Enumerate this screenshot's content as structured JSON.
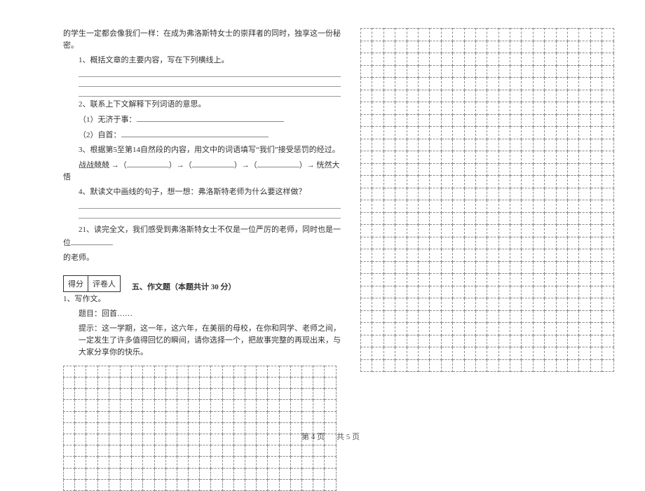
{
  "left": {
    "p0": "的学生一定都会像我们一样：在成为弗洛斯特女士的崇拜者的同时，独享这一份秘密。",
    "q1": "1、概括文章的主要内容，写在下列横线上。",
    "q2": "2、联系上下文解释下列词语的意思。",
    "q2a": "（1）无济于事：",
    "q2b": "（2）自首：",
    "q3": "3、根据第5至第14自然段的内容，用文中的词语填写“我们”接受惩罚的经过。",
    "q3line_a": "战战兢兢 →（",
    "q3line_b": "）→（",
    "q3line_c": "）→（",
    "q3line_d": "）→ 恍然大悟",
    "q4": "4、默读文中画线的句子，想一想：弗洛斯特老师为什么要这样做？",
    "q21a": "21、读完全文，我们感受到弗洛斯特女士不仅是一位严厉的老师，同时也是一位",
    "q21b": "的老师。",
    "score_label_1": "得分",
    "score_label_2": "评卷人",
    "section": "五、作文题（本题共计 30 分）",
    "essay_q": "1、写作文。",
    "essay_title": "题目：回首……",
    "essay_hint": "提示：这一学期，这一年，这六年，在美丽的母校，在你和同学、老师之间，一定发生了许多值得回忆的瞬间，请你选择一个，把故事完整的再现出来，与大家分享你的快乐。"
  },
  "footer_left": "第 4 页",
  "footer_right": "共 5 页"
}
